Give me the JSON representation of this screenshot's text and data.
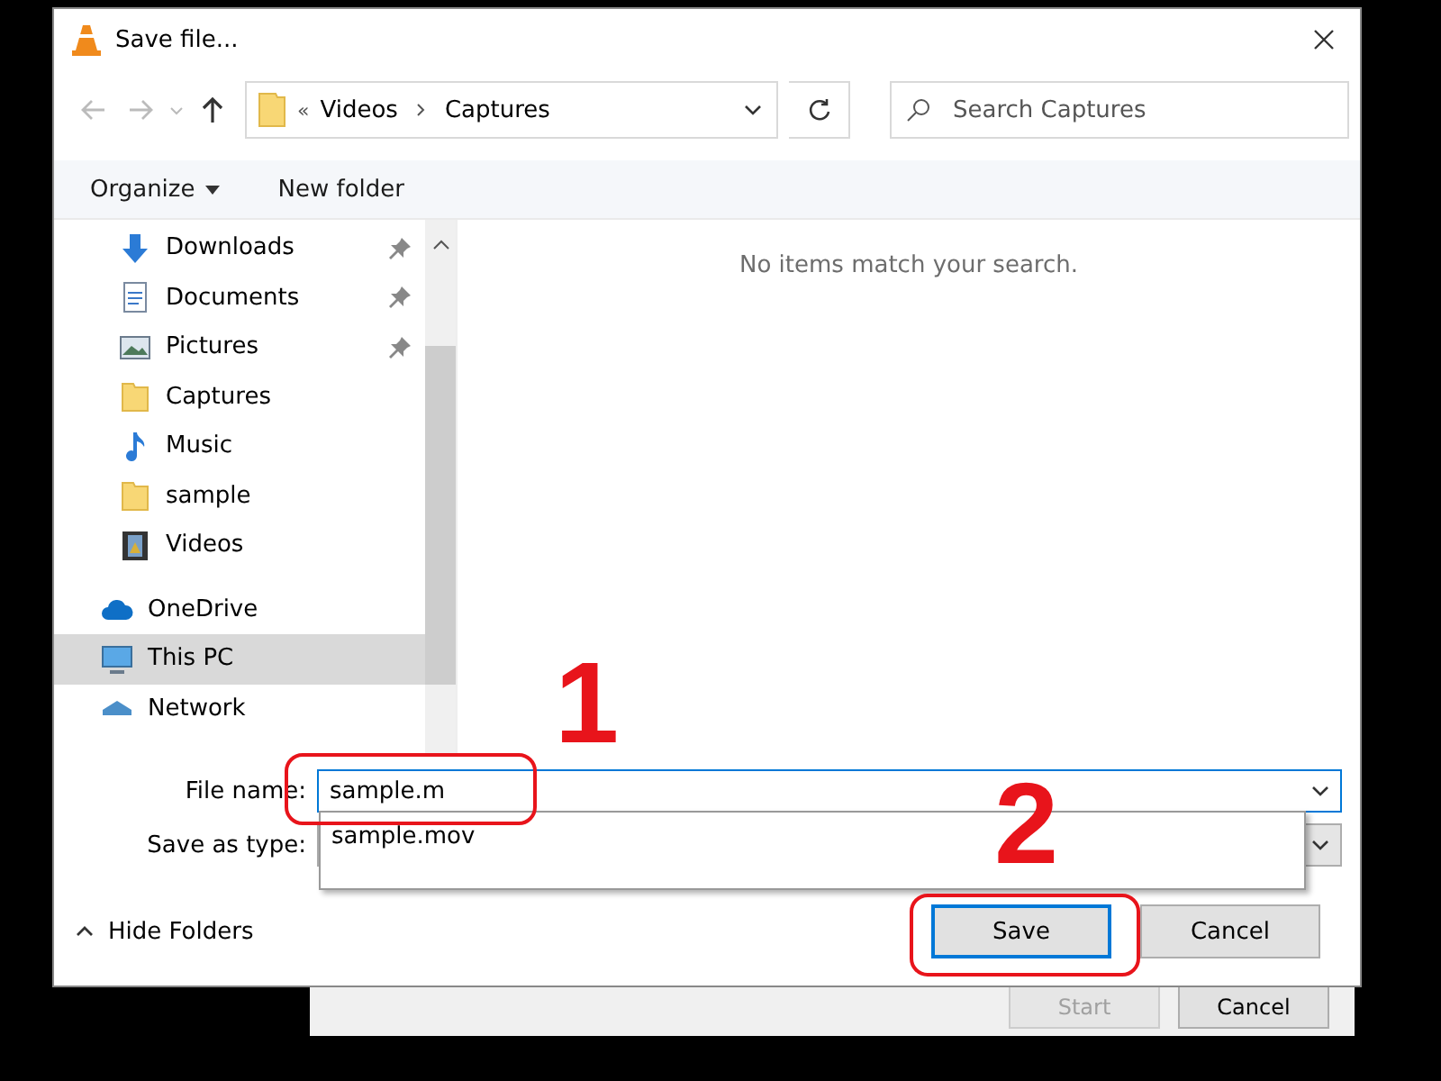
{
  "window": {
    "title": "Save file..."
  },
  "address": {
    "overflow": "«",
    "path": [
      "Videos",
      "Captures"
    ]
  },
  "search": {
    "placeholder": "Search Captures"
  },
  "toolbar": [
    {
      "label": "Organize",
      "kind": "menu"
    },
    {
      "label": "New folder",
      "kind": "plain"
    }
  ],
  "nav": [
    {
      "label": "Downloads",
      "kind": "download",
      "pinned": true,
      "selected": false
    },
    {
      "label": "Documents",
      "kind": "document",
      "pinned": true,
      "selected": false
    },
    {
      "label": "Pictures",
      "kind": "picture",
      "pinned": true,
      "selected": false
    },
    {
      "label": "Captures",
      "kind": "folder",
      "pinned": false,
      "selected": false
    },
    {
      "label": "Music",
      "kind": "music",
      "pinned": false,
      "selected": false
    },
    {
      "label": "sample",
      "kind": "folder",
      "pinned": false,
      "selected": false
    },
    {
      "label": "Videos",
      "kind": "video",
      "pinned": false,
      "selected": false
    }
  ],
  "locations": [
    {
      "label": "OneDrive",
      "kind": "cloud",
      "selected": false
    },
    {
      "label": "This PC",
      "kind": "pc",
      "selected": true
    },
    {
      "label": "Network",
      "kind": "network",
      "selected": false
    }
  ],
  "empty_message": "No items match your search.",
  "file_name": {
    "label": "File name:",
    "value": "sample.m"
  },
  "save_as_type": {
    "label": "Save as type:"
  },
  "suggestions": [
    "sample.mov"
  ],
  "hide_folders": "Hide Folders",
  "buttons": [
    {
      "label": "Save",
      "default": true
    },
    {
      "label": "Cancel",
      "default": false
    }
  ],
  "background_window": {
    "buttons": [
      {
        "label": "Start",
        "disabled": true
      },
      {
        "label": "Cancel",
        "disabled": false
      }
    ]
  },
  "annotations": [
    {
      "label": "1"
    },
    {
      "label": "2"
    }
  ]
}
